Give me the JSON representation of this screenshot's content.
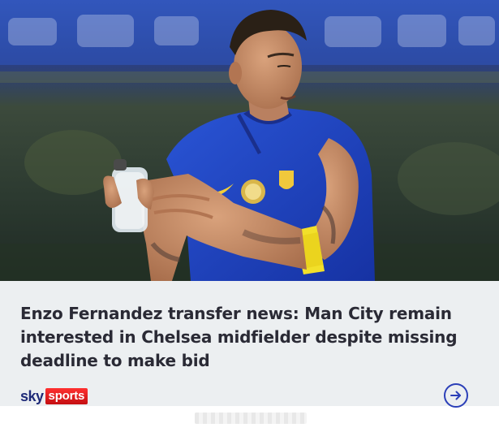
{
  "article": {
    "headline": "Enzo Fernandez transfer news: Man City remain interested in Chelsea midfielder despite missing deadline to make bid",
    "source": {
      "brand_part1": "sky",
      "brand_part2": "sports"
    },
    "open_icon": "arrow-right-circle-icon",
    "hero_image": "player-photo"
  },
  "colors": {
    "headline_text": "#2a2a35",
    "panel_background": "#eceff1",
    "brand_blue": "#1e2a78",
    "brand_red": "#e11b22",
    "arrow_blue": "#2b3fb8",
    "kit_blue": "#1c3fbf"
  }
}
